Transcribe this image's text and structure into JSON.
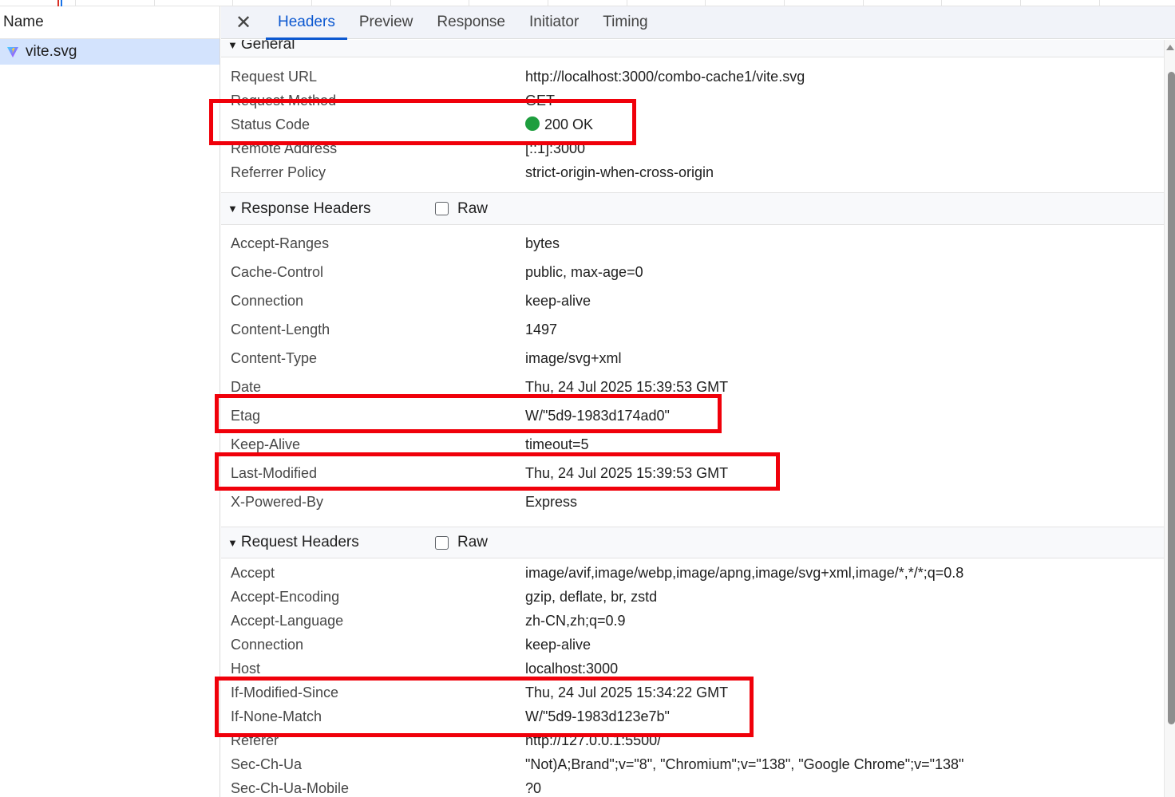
{
  "left_panel": {
    "column_header": "Name",
    "requests": [
      {
        "name": "vite.svg"
      }
    ]
  },
  "tabs": [
    {
      "label": "Headers",
      "active": true
    },
    {
      "label": "Preview",
      "active": false
    },
    {
      "label": "Response",
      "active": false
    },
    {
      "label": "Initiator",
      "active": false
    },
    {
      "label": "Timing",
      "active": false
    }
  ],
  "general": {
    "title": "General",
    "rows": [
      {
        "key": "Request URL",
        "value": "http://localhost:3000/combo-cache1/vite.svg"
      },
      {
        "key": "Request Method",
        "value": "GET"
      },
      {
        "key": "Status Code",
        "value": "200 OK"
      },
      {
        "key": "Remote Address",
        "value": "[::1]:3000"
      },
      {
        "key": "Referrer Policy",
        "value": "strict-origin-when-cross-origin"
      }
    ]
  },
  "response_headers": {
    "title": "Response Headers",
    "raw_label": "Raw",
    "raw_checked": false,
    "rows": [
      {
        "key": "Accept-Ranges",
        "value": "bytes"
      },
      {
        "key": "Cache-Control",
        "value": "public, max-age=0"
      },
      {
        "key": "Connection",
        "value": "keep-alive"
      },
      {
        "key": "Content-Length",
        "value": "1497"
      },
      {
        "key": "Content-Type",
        "value": "image/svg+xml"
      },
      {
        "key": "Date",
        "value": "Thu, 24 Jul 2025 15:39:53 GMT"
      },
      {
        "key": "Etag",
        "value": "W/\"5d9-1983d174ad0\""
      },
      {
        "key": "Keep-Alive",
        "value": "timeout=5"
      },
      {
        "key": "Last-Modified",
        "value": "Thu, 24 Jul 2025 15:39:53 GMT"
      },
      {
        "key": "X-Powered-By",
        "value": "Express"
      }
    ]
  },
  "request_headers": {
    "title": "Request Headers",
    "raw_label": "Raw",
    "raw_checked": false,
    "rows": [
      {
        "key": "Accept",
        "value": "image/avif,image/webp,image/apng,image/svg+xml,image/*,*/*;q=0.8"
      },
      {
        "key": "Accept-Encoding",
        "value": "gzip, deflate, br, zstd"
      },
      {
        "key": "Accept-Language",
        "value": "zh-CN,zh;q=0.9"
      },
      {
        "key": "Connection",
        "value": "keep-alive"
      },
      {
        "key": "Host",
        "value": "localhost:3000"
      },
      {
        "key": "If-Modified-Since",
        "value": "Thu, 24 Jul 2025 15:34:22 GMT"
      },
      {
        "key": "If-None-Match",
        "value": "W/\"5d9-1983d123e7b\""
      },
      {
        "key": "Referer",
        "value": "http://127.0.0.1:5500/"
      },
      {
        "key": "Sec-Ch-Ua",
        "value": "\"Not)A;Brand\";v=\"8\", \"Chromium\";v=\"138\", \"Google Chrome\";v=\"138\""
      },
      {
        "key": "Sec-Ch-Ua-Mobile",
        "value": "?0"
      }
    ]
  },
  "colors": {
    "accent": "#0b57d0",
    "selected_row": "#d3e3fd",
    "status_ok": "#1e9e3e",
    "highlight_box": "#f0000a"
  },
  "icons": {
    "close": "close-icon",
    "favicon": "vite-icon",
    "disclosure": "triangle-down-icon"
  }
}
